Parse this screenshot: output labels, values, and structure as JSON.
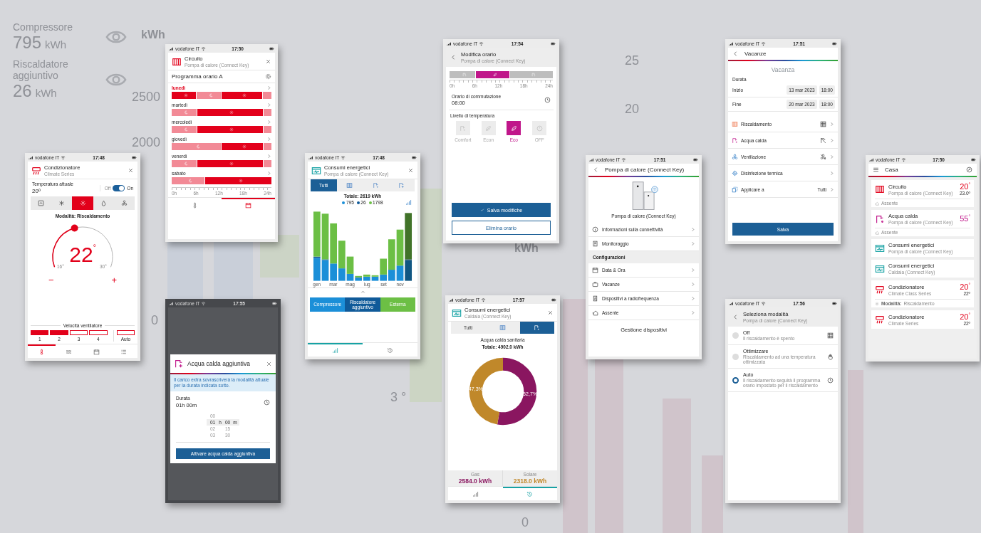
{
  "background": {
    "legend": [
      {
        "label": "Compressore",
        "value": "795",
        "unit": "kWh"
      },
      {
        "label": "Riscaldatore aggiuntivo",
        "value": "26",
        "unit": "kWh"
      }
    ],
    "left_axis": {
      "unit": "kWh",
      "ticks": [
        "2500",
        "2000",
        "0"
      ]
    },
    "right_axis": {
      "unit": "kWh",
      "ticks": [
        "25",
        "20"
      ]
    },
    "other_labels": [
      "3 °",
      "0"
    ]
  },
  "phones": [
    {
      "kind": "climate",
      "carrier": "vodafone IT",
      "time": "17:48",
      "title": "Condizionatore",
      "subtitle": "Climate Series",
      "temp_label": "Temperatura attuale",
      "temp": "20º",
      "toggle": {
        "off_label": "Off",
        "on_label": "On",
        "on": true
      },
      "modes": [
        {
          "kind": "auto",
          "selected": false
        },
        {
          "kind": "cool",
          "selected": false
        },
        {
          "kind": "heat",
          "selected": true
        },
        {
          "kind": "dry",
          "selected": false
        },
        {
          "kind": "fan",
          "selected": false
        }
      ],
      "mode_text": "Modalità: Riscaldamento",
      "dial": {
        "setpoint": "22$^{°}$",
        "min": "16°",
        "max": "30°",
        "minus": "−",
        "plus": "+"
      },
      "fan_label": "Velocità ventilatore",
      "fan_levels": [
        {
          "label": "1",
          "on": true
        },
        {
          "label": "2",
          "on": true
        },
        {
          "label": "3",
          "on": false
        },
        {
          "label": "4",
          "on": false
        },
        {
          "label": "Auto",
          "on": false
        }
      ],
      "nav": [
        {
          "kind": "thermostat",
          "selected": true
        },
        {
          "kind": "program",
          "selected": false
        },
        {
          "kind": "timer",
          "selected": false
        },
        {
          "kind": "list",
          "selected": false
        }
      ]
    },
    {
      "kind": "schedule",
      "carrier": "vodafone IT",
      "time": "17:50",
      "title": "Circuito",
      "subtitle": "Pompa di calore (Connect Key)",
      "program": "Programma orario A",
      "days": [
        {
          "name": "lunedì",
          "selected": true,
          "slots": [
            {
              "kind": "comfort"
            },
            {
              "kind": "comfort"
            },
            {
              "kind": "comfort"
            },
            {
              "kind": "comfort"
            },
            {
              "kind": "comfort"
            },
            {
              "kind": "comfort"
            },
            {
              "kind": "eco"
            },
            {
              "kind": "eco"
            },
            {
              "kind": "eco"
            },
            {
              "kind": "eco"
            },
            {
              "kind": "eco"
            },
            {
              "kind": "eco"
            },
            {
              "kind": "comfort"
            },
            {
              "kind": "comfort"
            },
            {
              "kind": "comfort"
            },
            {
              "kind": "comfort"
            },
            {
              "kind": "comfort"
            },
            {
              "kind": "comfort"
            },
            {
              "kind": "comfort"
            },
            {
              "kind": "comfort"
            },
            {
              "kind": "comfort"
            },
            {
              "kind": "comfort"
            },
            {
              "kind": "eco"
            },
            {
              "kind": "eco"
            }
          ]
        },
        {
          "name": "martedì",
          "selected": false,
          "slots": [
            {
              "kind": "eco"
            },
            {
              "kind": "eco"
            },
            {
              "kind": "eco"
            },
            {
              "kind": "eco"
            },
            {
              "kind": "eco"
            },
            {
              "kind": "eco"
            },
            {
              "kind": "comfort"
            },
            {
              "kind": "comfort"
            },
            {
              "kind": "comfort"
            },
            {
              "kind": "comfort"
            },
            {
              "kind": "comfort"
            },
            {
              "kind": "comfort"
            },
            {
              "kind": "comfort"
            },
            {
              "kind": "comfort"
            },
            {
              "kind": "comfort"
            },
            {
              "kind": "comfort"
            },
            {
              "kind": "comfort"
            },
            {
              "kind": "comfort"
            },
            {
              "kind": "comfort"
            },
            {
              "kind": "comfort"
            },
            {
              "kind": "comfort"
            },
            {
              "kind": "comfort"
            },
            {
              "kind": "eco"
            },
            {
              "kind": "eco"
            }
          ]
        },
        {
          "name": "mercoledì",
          "selected": false,
          "slots": [
            {
              "kind": "eco"
            },
            {
              "kind": "eco"
            },
            {
              "kind": "eco"
            },
            {
              "kind": "eco"
            },
            {
              "kind": "eco"
            },
            {
              "kind": "eco"
            },
            {
              "kind": "comfort"
            },
            {
              "kind": "comfort"
            },
            {
              "kind": "comfort"
            },
            {
              "kind": "comfort"
            },
            {
              "kind": "comfort"
            },
            {
              "kind": "comfort"
            },
            {
              "kind": "comfort"
            },
            {
              "kind": "comfort"
            },
            {
              "kind": "comfort"
            },
            {
              "kind": "comfort"
            },
            {
              "kind": "comfort"
            },
            {
              "kind": "comfort"
            },
            {
              "kind": "comfort"
            },
            {
              "kind": "comfort"
            },
            {
              "kind": "comfort"
            },
            {
              "kind": "comfort"
            },
            {
              "kind": "eco"
            },
            {
              "kind": "eco"
            }
          ]
        },
        {
          "name": "giovedì",
          "selected": false,
          "slots": [
            {
              "kind": "eco"
            },
            {
              "kind": "eco"
            },
            {
              "kind": "eco"
            },
            {
              "kind": "eco"
            },
            {
              "kind": "eco"
            },
            {
              "kind": "eco"
            },
            {
              "kind": "eco"
            },
            {
              "kind": "eco"
            },
            {
              "kind": "eco"
            },
            {
              "kind": "eco"
            },
            {
              "kind": "eco"
            },
            {
              "kind": "eco"
            },
            {
              "kind": "comfort"
            },
            {
              "kind": "comfort"
            },
            {
              "kind": "comfort"
            },
            {
              "kind": "comfort"
            },
            {
              "kind": "comfort"
            },
            {
              "kind": "comfort"
            },
            {
              "kind": "comfort"
            },
            {
              "kind": "comfort"
            },
            {
              "kind": "comfort"
            },
            {
              "kind": "comfort"
            },
            {
              "kind": "eco"
            },
            {
              "kind": "eco"
            }
          ]
        },
        {
          "name": "venerdì",
          "selected": false,
          "slots": [
            {
              "kind": "eco"
            },
            {
              "kind": "eco"
            },
            {
              "kind": "eco"
            },
            {
              "kind": "eco"
            },
            {
              "kind": "eco"
            },
            {
              "kind": "eco"
            },
            {
              "kind": "comfort"
            },
            {
              "kind": "comfort"
            },
            {
              "kind": "comfort"
            },
            {
              "kind": "comfort"
            },
            {
              "kind": "comfort"
            },
            {
              "kind": "comfort"
            },
            {
              "kind": "comfort"
            },
            {
              "kind": "comfort"
            },
            {
              "kind": "comfort"
            },
            {
              "kind": "comfort"
            },
            {
              "kind": "comfort"
            },
            {
              "kind": "comfort"
            },
            {
              "kind": "comfort"
            },
            {
              "kind": "comfort"
            },
            {
              "kind": "comfort"
            },
            {
              "kind": "comfort"
            },
            {
              "kind": "eco"
            },
            {
              "kind": "eco"
            }
          ]
        },
        {
          "name": "sabato",
          "selected": false,
          "slots": [
            {
              "kind": "eco"
            },
            {
              "kind": "eco"
            },
            {
              "kind": "eco"
            },
            {
              "kind": "eco"
            },
            {
              "kind": "eco"
            },
            {
              "kind": "eco"
            },
            {
              "kind": "eco"
            },
            {
              "kind": "eco"
            },
            {
              "kind": "comfort"
            },
            {
              "kind": "comfort"
            },
            {
              "kind": "comfort"
            },
            {
              "kind": "comfort"
            },
            {
              "kind": "comfort"
            },
            {
              "kind": "comfort"
            },
            {
              "kind": "comfort"
            },
            {
              "kind": "comfort"
            },
            {
              "kind": "comfort"
            },
            {
              "kind": "comfort"
            },
            {
              "kind": "comfort"
            },
            {
              "kind": "comfort"
            },
            {
              "kind": "comfort"
            },
            {
              "kind": "comfort"
            },
            {
              "kind": "comfort"
            },
            {
              "kind": "comfort"
            }
          ]
        }
      ],
      "axis": [
        "0h",
        "6h",
        "12h",
        "18h",
        "24h"
      ],
      "nav": [
        {
          "kind": "thermostat",
          "selected": false
        },
        {
          "kind": "calendar",
          "selected": true
        }
      ]
    },
    {
      "kind": "boost",
      "carrier": "vodafone IT",
      "time": "17:55",
      "title": "Acqua calda aggiuntiva",
      "info": "Il carico extra sovrascriverà la modalità attuale per la durata indicata sotto.",
      "duration_label": "Durata",
      "duration": "01h 00m",
      "hour_unit": "h",
      "minute_unit": "m",
      "picker": [
        {
          "hours": "00",
          "selected": false
        },
        {
          "hours": "01",
          "minutes": "00",
          "selected": true
        },
        {
          "hours": "02",
          "minutes": "15",
          "selected": false
        },
        {
          "hours": "03",
          "minutes": "30",
          "selected": false
        }
      ],
      "button": "Attivare acqua calda aggiuntiva"
    },
    {
      "kind": "energy",
      "carrier": "vodafone IT",
      "time": "17:48",
      "title": "Consumi energetici",
      "subtitle": "Pompa di calore (Connect Key)",
      "tabs": [
        {
          "kind": "all",
          "label": "Tutti",
          "selected": true
        },
        {
          "kind": "heating",
          "selected": false
        },
        {
          "kind": "hot-water",
          "selected": false
        },
        {
          "kind": "extra-hot-water",
          "selected": false
        }
      ],
      "total": "Totale: 2619 kWh",
      "legend": [
        {
          "value": "795",
          "color": "#1b8fd8"
        },
        {
          "value": "26",
          "color": "#0f5a99"
        },
        {
          "value": "1798",
          "color": "#6cbf45"
        }
      ],
      "months": [
        "gen",
        "mar",
        "mag",
        "lug",
        "set",
        "nov"
      ],
      "sources": [
        {
          "label": "Compressore",
          "color": "#1b8fd8"
        },
        {
          "label": "Riscaldatore aggiuntivo",
          "color": "#0f5a99"
        },
        {
          "label": "Esterna",
          "color": "#6cbf45"
        }
      ],
      "nav": [
        {
          "kind": "chart",
          "selected": true
        },
        {
          "kind": "history",
          "selected": false
        }
      ]
    },
    {
      "kind": "edit",
      "carrier": "vodafone IT",
      "time": "17:54",
      "title": "Modifica orario",
      "subtitle": "Pompa di calore (Connect Key)",
      "slots": [
        {
          "selected": false
        },
        {
          "selected": false
        },
        {
          "selected": false
        },
        {
          "selected": false
        },
        {
          "selected": false
        },
        {
          "selected": false
        },
        {
          "selected": true
        },
        {
          "selected": true
        },
        {
          "selected": true
        },
        {
          "selected": true
        },
        {
          "selected": true
        },
        {
          "selected": true
        },
        {
          "selected": true
        },
        {
          "selected": true
        },
        {
          "selected": false
        },
        {
          "selected": false
        },
        {
          "selected": false
        },
        {
          "selected": false
        },
        {
          "selected": false
        },
        {
          "selected": false
        },
        {
          "selected": false
        },
        {
          "selected": false
        },
        {
          "selected": false
        },
        {
          "selected": false
        }
      ],
      "axis": [
        "0h",
        "6h",
        "12h",
        "18h",
        "24h"
      ],
      "switch_label": "Orario di commutazione",
      "switch_time": "08:00",
      "level_label": "Livello di temperatura",
      "levels": [
        {
          "kind": "comfort",
          "label": "Comfort",
          "selected": false
        },
        {
          "kind": "econ",
          "label": "Econ",
          "selected": false
        },
        {
          "kind": "eco",
          "label": "Eco",
          "selected": true
        },
        {
          "kind": "off",
          "label": "OFF",
          "selected": false
        }
      ],
      "save": "Salva modifiche",
      "delete": "Elimina orario"
    },
    {
      "kind": "device",
      "carrier": "vodafone IT",
      "time": "17:51",
      "title": "Pompa di calore (Connect Key)",
      "device_name": "Pompa di calore (Connect Key)",
      "items": [
        {
          "kind": "info",
          "label": "Informazioni sulla connettività"
        },
        {
          "kind": "monitoring",
          "label": "Monitoraggio"
        },
        {
          "kind": "header",
          "label": "Configurazioni"
        },
        {
          "kind": "date",
          "label": "Data & Ora"
        },
        {
          "kind": "holiday",
          "label": "Vacanze"
        },
        {
          "kind": "radio",
          "label": "Dispositivi a radiofrequenza"
        },
        {
          "kind": "away",
          "label": "Assente"
        }
      ],
      "footer": "Gestione dispositivi"
    },
    {
      "kind": "donut",
      "carrier": "vodafone IT",
      "time": "17:57",
      "title": "Consumi energetici",
      "subtitle": "Caldaia (Connect Key)",
      "tabs": [
        {
          "kind": "all",
          "label": "Tutti",
          "selected": false
        },
        {
          "kind": "heating",
          "selected": false
        },
        {
          "kind": "hot-water",
          "selected": true
        }
      ],
      "heading": "Acqua calda sanitaria",
      "total": "Totale: 4902.0 kWh",
      "chart_data": {
        "type": "donut",
        "categories": [
          "Gas",
          "Solare"
        ],
        "values": [
          52.7,
          47.3
        ],
        "value_labels": [
          "52,7%",
          "47,3%"
        ]
      },
      "summary": [
        {
          "value": "2584.0 kWh",
          "color": "#8a1660"
        },
        {
          "value": "2318.0 kWh",
          "color": "#c0882a"
        }
      ],
      "nav": [
        {
          "kind": "chart",
          "selected": false
        },
        {
          "kind": "history",
          "selected": true
        }
      ]
    },
    {
      "kind": "vacation",
      "carrier": "vodafone IT",
      "time": "17:51",
      "title": "Vacanze",
      "heading": "Vacanza",
      "duration_label": "Durata",
      "dates": [
        {
          "label": "Inizio",
          "date": "13 mar 2023",
          "time": "18:00"
        },
        {
          "label": "Fine",
          "date": "20 mar 2023",
          "time": "18:00"
        }
      ],
      "items": [
        {
          "kind": "heating",
          "label": "Riscaldamento"
        },
        {
          "kind": "hot-water",
          "label": "Acqua calda"
        },
        {
          "kind": "ventilation",
          "label": "Ventilazione"
        },
        {
          "kind": "disinfection",
          "label": "Disinfezione termica"
        },
        {
          "kind": "apply",
          "label": "Applicare a",
          "value": "Tutti"
        }
      ],
      "button": "Salva"
    },
    {
      "kind": "mode",
      "carrier": "vodafone IT",
      "time": "17:56",
      "title": "Seleziona modalità",
      "subtitle": "Pompa di calore (Connect Key)",
      "options": [
        {
          "kind": "off",
          "title": "Off",
          "description": "Il riscaldamento è spento",
          "selected": false
        },
        {
          "kind": "optimize",
          "title": "Ottimizzare",
          "description": "Riscaldamento ad una temperatura ottimizzata",
          "selected": false
        },
        {
          "kind": "auto",
          "title": "Auto",
          "description": "Il riscaldamento seguirà il programma orario impostato per il riscaldamento",
          "selected": true
        }
      ]
    },
    {
      "kind": "home",
      "carrier": "vodafone IT",
      "time": "17:50",
      "title": "Casa",
      "cards": [
        {
          "kind": "heating",
          "title": "Circuito",
          "subtitle": "Pompa di calore (Connect Key)",
          "temp": "20$^{°}$",
          "setpoint": "23.0º",
          "footer": {
            "kind": "away",
            "text": "Assente"
          }
        },
        {
          "kind": "hot-water",
          "title": "Acqua calda",
          "subtitle": "Pompa di calore (Connect Key)",
          "temp": "55$^{°}$",
          "footer": {
            "kind": "away",
            "text": "Assente"
          }
        },
        {
          "kind": "energy",
          "title": "Consumi energetici",
          "subtitle": "Pompa di calore (Connect Key)"
        },
        {
          "kind": "energy",
          "title": "Consumi energetici",
          "subtitle": "Caldaia (Connect Key)"
        },
        {
          "kind": "aircon",
          "title": "Condizionatore",
          "subtitle": "Climate Class Series",
          "temp": "20$^{°}$",
          "setpoint": "22º",
          "footer": {
            "kind": "mode",
            "label": "Modalità:",
            "text": "Riscaldamento"
          }
        },
        {
          "kind": "aircon",
          "title": "Condizionatore",
          "subtitle": "Climate Series",
          "temp": "20$^{°}$",
          "setpoint": "22º"
        }
      ]
    }
  ]
}
